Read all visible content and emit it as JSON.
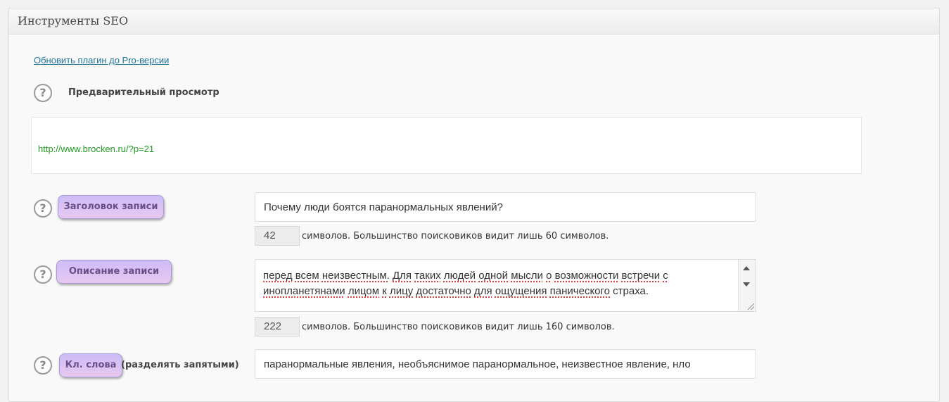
{
  "panel": {
    "title": "Инструменты SEO",
    "upgrade_link": "Обновить плагин до Pro-версии"
  },
  "preview": {
    "label": "Предварительный просмотр",
    "url": "http://www.brocken.ru/?p=21"
  },
  "title_field": {
    "label": "Заголовок записи",
    "value": "Почему люди боятся паранормальных явлений?",
    "count": "42",
    "note": "символов. Большинство поисковиков видит лишь 60 символов."
  },
  "description_field": {
    "label": "Описание записи",
    "line1_words": [
      "перед",
      "всем",
      "неизвестным.",
      "Для",
      "таких",
      "людей",
      "одной",
      "мысли",
      "о",
      "возможности",
      "встречи",
      "с"
    ],
    "line2_words": [
      "инопланетянами",
      "лицом",
      "к",
      "лицу",
      "достаточно",
      "для",
      "ощущения",
      "панического",
      "страха."
    ],
    "count": "222",
    "note": "символов. Большинство поисковиков видит лишь 160 символов."
  },
  "keywords_field": {
    "label": "Кл. слова",
    "hint": "(разделять запятыми)",
    "value": "паранормальные явления, необъяснимое паранормальное, неизвестное явление, нло"
  },
  "help_icon_glyph": "?",
  "colors": {
    "link": "#21759b",
    "url_green": "#1e9d1e",
    "pill_bg": "#d8c2f4"
  }
}
